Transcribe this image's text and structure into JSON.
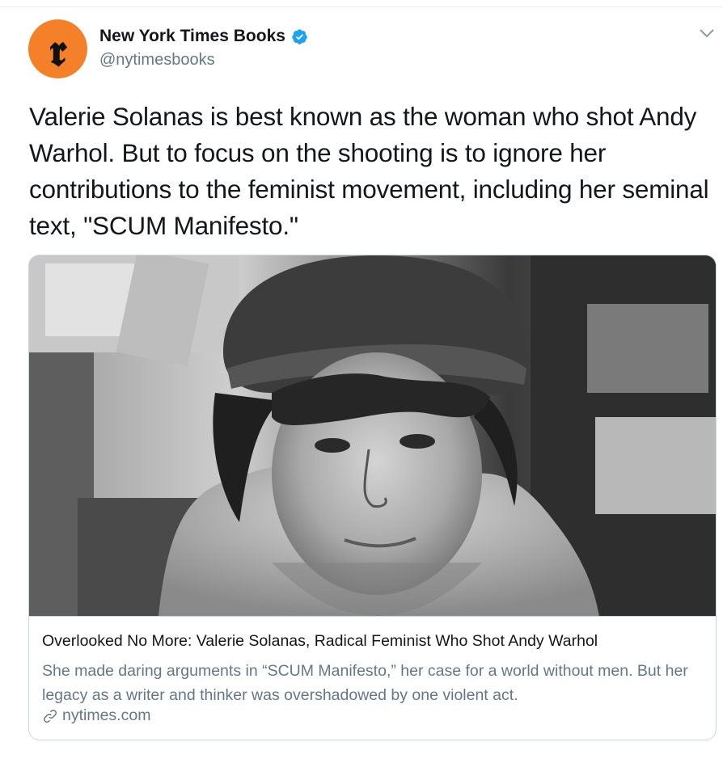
{
  "tweet": {
    "avatar_glyph": "𝖗",
    "display_name": "New York Times Books",
    "verified": true,
    "handle": "@nytimesbooks",
    "text": "Valerie Solanas is best known as the woman who shot Andy Warhol. But to focus on the shooting is to ignore her contributions to the feminist movement, including her seminal text, \"SCUM Manifesto.\""
  },
  "card": {
    "title": "Overlooked No More: Valerie Solanas, Radical Feminist Who Shot Andy Warhol",
    "description": "She made daring arguments in “SCUM Manifesto,” her case for a world without men. But her legacy as a writer and thinker was overshadowed by one violent act.",
    "domain": "nytimes.com"
  },
  "colors": {
    "avatar_bg": "#f4812a",
    "verified_blue": "#1da1f2",
    "secondary_text": "#657786",
    "border": "#ccd6dd"
  },
  "icons": {
    "avatar": "nyt-logo-icon",
    "verified": "verified-badge-icon",
    "menu": "chevron-down-icon",
    "link": "link-icon"
  }
}
